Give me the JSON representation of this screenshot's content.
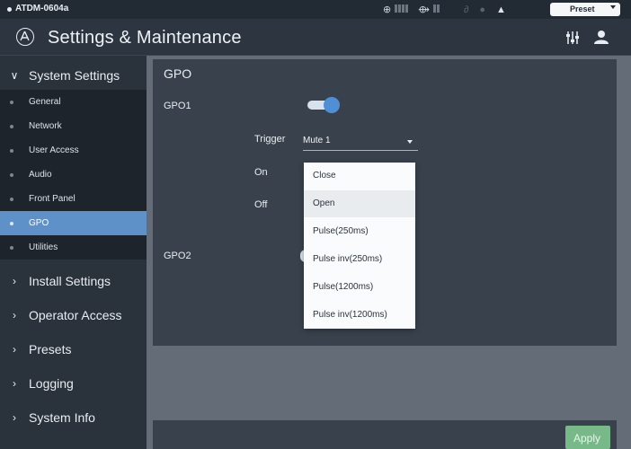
{
  "status_bar": {
    "device_name": "ATDM-0604a",
    "preset_label": "Preset"
  },
  "header": {
    "title": "Settings & Maintenance"
  },
  "sidebar": {
    "system_settings": "System Settings",
    "system_items": [
      {
        "label": "General"
      },
      {
        "label": "Network"
      },
      {
        "label": "User Access"
      },
      {
        "label": "Audio"
      },
      {
        "label": "Front Panel"
      },
      {
        "label": "GPO",
        "selected": true
      },
      {
        "label": "Utilities"
      }
    ],
    "sections": [
      {
        "label": "Install Settings"
      },
      {
        "label": "Operator Access"
      },
      {
        "label": "Presets"
      },
      {
        "label": "Logging"
      },
      {
        "label": "System Info"
      }
    ]
  },
  "main": {
    "panel_title": "GPO",
    "gpo1": {
      "label": "GPO1",
      "enabled": true,
      "trigger_label": "Trigger",
      "trigger_value": "Mute 1",
      "on_label": "On",
      "off_label": "Off"
    },
    "gpo2": {
      "label": "GPO2"
    },
    "dropdown_options": [
      {
        "label": "Close"
      },
      {
        "label": "Open",
        "highlighted": true
      },
      {
        "label": "Pulse(250ms)"
      },
      {
        "label": "Pulse inv(250ms)"
      },
      {
        "label": "Pulse(1200ms)"
      },
      {
        "label": "Pulse inv(1200ms)"
      }
    ],
    "apply_label": "Apply"
  },
  "colors": {
    "accent": "#5f91c9",
    "toggle_on": "#4f8fd6",
    "apply": "#78b98a",
    "panel": "#39424c",
    "sidebar": "#2a323b"
  },
  "icons": [
    "logo-icon",
    "mixer-icon",
    "user-icon",
    "chevron-down-icon",
    "chevron-right-icon",
    "network-status-icon",
    "link-icon",
    "warning-icon"
  ]
}
